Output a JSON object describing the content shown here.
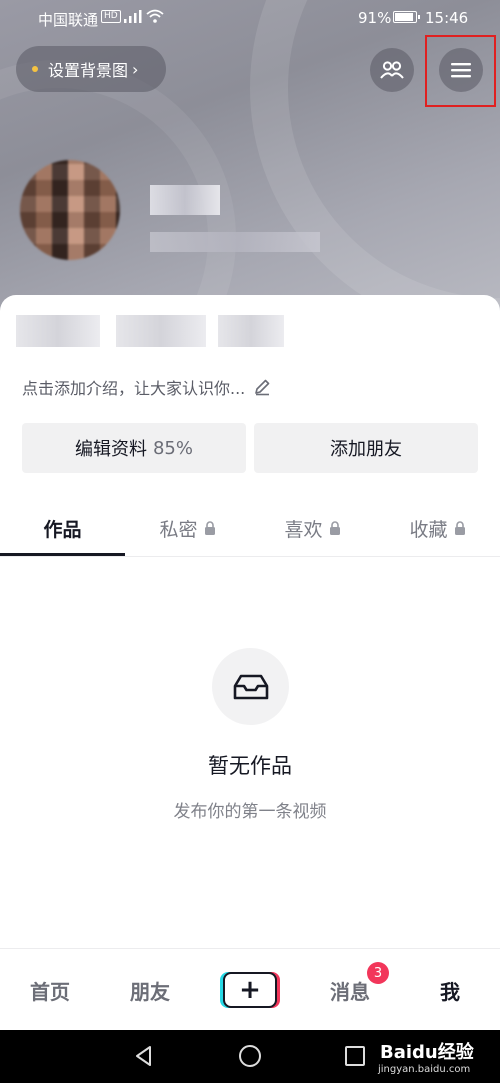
{
  "status_bar": {
    "carrier": "中国联通",
    "network_badge": "HD",
    "battery_percent": "91%",
    "battery_level": 0.91,
    "time": "15:46"
  },
  "header": {
    "set_background_label": "设置背景图",
    "set_background_chevron": "›",
    "accent_dot_color": "#f5c342"
  },
  "profile": {
    "bio_prompt": "点击添加介绍，让大家认识你...",
    "edit_profile_label": "编辑资料",
    "edit_profile_progress": "85%",
    "add_friends_label": "添加朋友"
  },
  "tabs": [
    {
      "label": "作品",
      "locked": false,
      "active": true
    },
    {
      "label": "私密",
      "locked": true,
      "active": false
    },
    {
      "label": "喜欢",
      "locked": true,
      "active": false
    },
    {
      "label": "收藏",
      "locked": true,
      "active": false
    }
  ],
  "empty_state": {
    "title": "暂无作品",
    "subtitle": "发布你的第一条视频"
  },
  "tab_bar": {
    "home": "首页",
    "friends": "朋友",
    "create": "+",
    "messages": "消息",
    "messages_badge": "3",
    "me": "我"
  },
  "watermark": {
    "brand": "Baidu经验",
    "url": "jingyan.baidu.com"
  },
  "colors": {
    "highlight_box": "#e02020",
    "badge": "#f2365a",
    "plus_left_accent": "#26d9e6",
    "plus_right_accent": "#f2365a"
  }
}
